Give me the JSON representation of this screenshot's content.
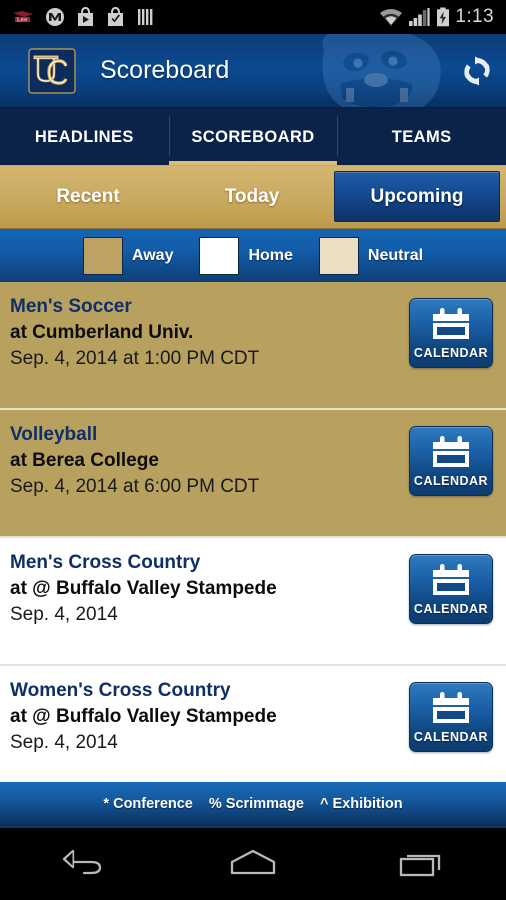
{
  "status_bar": {
    "time": "1:13",
    "left_icons": [
      "lee-logo-icon",
      "motorola-icon",
      "play-store-icon",
      "play-store-check-icon",
      "bars-icon"
    ],
    "right_icons": [
      "wifi-icon",
      "signal-icon",
      "battery-charging-icon"
    ]
  },
  "header": {
    "title": "Scoreboard",
    "logo_name": "uc-shield-logo",
    "mascot_name": "bulldog-mascot-watermark",
    "refresh_name": "refresh-icon",
    "bg_color": "#0b4a90"
  },
  "tabs": [
    {
      "label": "HEADLINES",
      "active": false
    },
    {
      "label": "SCOREBOARD",
      "active": true
    },
    {
      "label": "TEAMS",
      "active": false
    }
  ],
  "subtabs": [
    {
      "label": "Recent",
      "active": false
    },
    {
      "label": "Today",
      "active": false
    },
    {
      "label": "Upcoming",
      "active": true
    }
  ],
  "legend": [
    {
      "label": "Away",
      "color": "#bda263"
    },
    {
      "label": "Home",
      "color": "#ffffff"
    },
    {
      "label": "Neutral",
      "color": "#eadfc2"
    }
  ],
  "games": [
    {
      "sport": "Men's Soccer",
      "opponent": "at Cumberland Univ.",
      "datetime": "Sep. 4, 2014 at 1:00 PM CDT",
      "venue_type": "away",
      "button_label": "CALENDAR"
    },
    {
      "sport": "Volleyball",
      "opponent": "at Berea College",
      "datetime": "Sep. 4, 2014 at 6:00 PM CDT",
      "venue_type": "away",
      "button_label": "CALENDAR"
    },
    {
      "sport": "Men's Cross Country",
      "opponent": "at @ Buffalo Valley Stampede",
      "datetime": "Sep. 4, 2014",
      "venue_type": "home",
      "button_label": "CALENDAR"
    },
    {
      "sport": "Women's Cross Country",
      "opponent": "at @ Buffalo Valley Stampede",
      "datetime": "Sep. 4, 2014",
      "venue_type": "home",
      "button_label": "CALENDAR"
    }
  ],
  "footnote": {
    "conference": "* Conference",
    "scrimmage": "% Scrimmage",
    "exhibition": "^ Exhibition"
  },
  "navbar": {
    "back": "back-icon",
    "home": "home-icon",
    "recents": "recents-icon"
  }
}
